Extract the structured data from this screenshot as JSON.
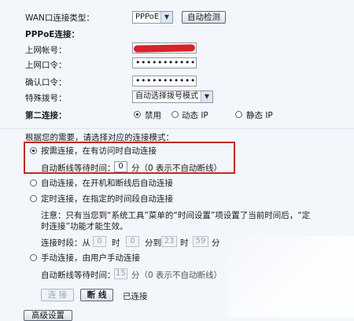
{
  "wan": {
    "type_label": "WAN口连接类型：",
    "type_value": "PPPoE",
    "detect_button": "自动检测"
  },
  "pppoe": {
    "section_title": "PPPoE连接：",
    "account_label": "上网帐号：",
    "password_label": "上网口令：",
    "password_mask": "••••••••••••",
    "confirm_label": "确认口令：",
    "confirm_mask": "••••••••••••",
    "dial_label": "特殊拨号：",
    "dial_value": "自动选择拨号模式"
  },
  "second": {
    "label": "第二连接：",
    "options": [
      "禁用",
      "动态 IP",
      "静态 IP"
    ]
  },
  "mode": {
    "prompt": "根据您的需要，请选择对应的连接模式：",
    "demand": {
      "label": "按需连接，在有访问时自动连接",
      "idle_prefix": "自动断线等待时间：",
      "idle_value": "0",
      "idle_suffix": "分（0 表示不自动断线）"
    },
    "auto": {
      "label": "自动连接，在开机和断线后自动连接"
    },
    "timed": {
      "label": "定时连接，在指定的时间段自动连接",
      "note_line1": "注意：只有当您到“系统工具”菜单的“时间设置”项设置了当前时间后，“定",
      "note_line2": "时连接”功能才能生效。",
      "period_prefix": "连接时段：从",
      "start_h": "0",
      "hour": "时",
      "start_m": "0",
      "to": "分到",
      "end_h": "23",
      "end_m": "59",
      "minute": "分"
    },
    "manual": {
      "label": "手动连接，由用户手动连接",
      "idle_prefix": "自动断线等待时间：",
      "idle_value": "15",
      "idle_suffix": "分（0 表示不自动断线）"
    }
  },
  "actions": {
    "connect": "连 接",
    "disconnect": "断 线",
    "status": "已连接",
    "advanced": "高级设置"
  }
}
